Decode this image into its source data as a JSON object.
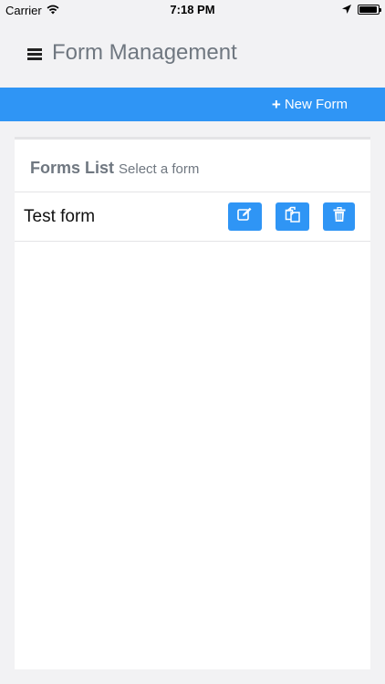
{
  "status_bar": {
    "carrier": "Carrier",
    "time": "7:18 PM"
  },
  "header": {
    "title": "Form Management",
    "menu_icon": "hamburger-icon"
  },
  "action_bar": {
    "new_form_label": "New Form",
    "new_form_icon": "plus-icon"
  },
  "forms_list": {
    "title": "Forms List",
    "subtitle": "Select a form",
    "items": [
      {
        "name": "Test form",
        "actions": [
          "edit-icon",
          "copy-icon",
          "trash-icon"
        ]
      }
    ]
  },
  "colors": {
    "accent": "#2f95f5",
    "background": "#f2f2f4",
    "title_text": "#6f7780"
  }
}
